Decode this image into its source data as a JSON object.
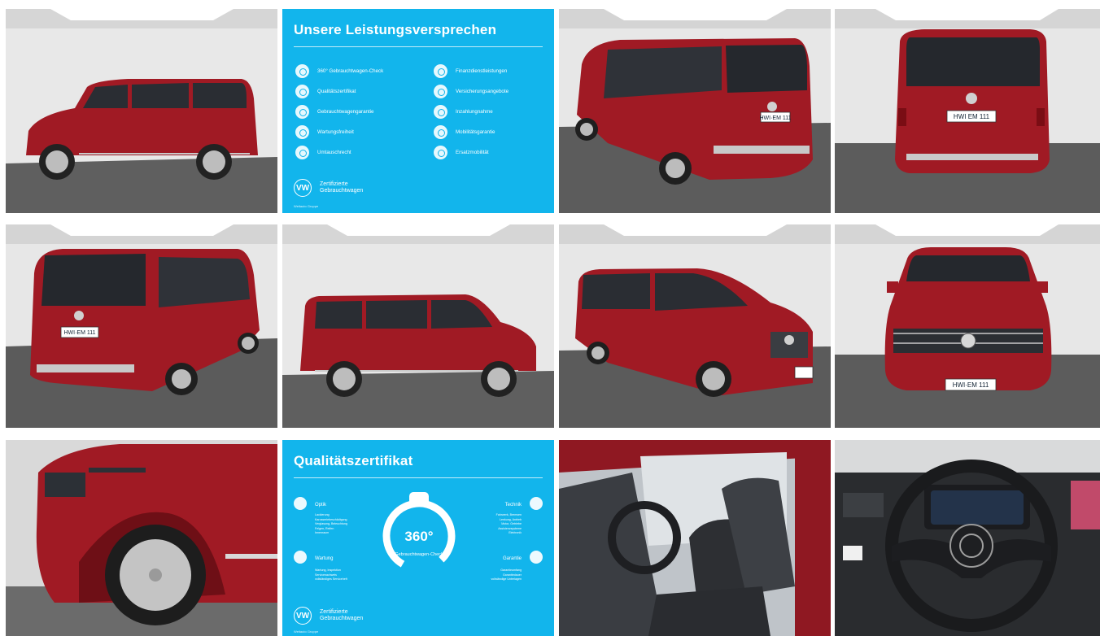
{
  "gallery": {
    "images": [
      {
        "view": "side-left-exterior"
      },
      {
        "view": "promo-services"
      },
      {
        "view": "rear-left-three-quarter"
      },
      {
        "view": "rear"
      },
      {
        "view": "rear-right-three-quarter"
      },
      {
        "view": "side-right-exterior"
      },
      {
        "view": "front-right-three-quarter"
      },
      {
        "view": "front"
      },
      {
        "view": "front-wheel-detail"
      },
      {
        "view": "promo-quality-certificate"
      },
      {
        "view": "interior-front-seats"
      },
      {
        "view": "steering-wheel-cockpit"
      }
    ]
  },
  "vehicle": {
    "plate": "HWI·EM 111",
    "plate_rear_short": "HWI EM 111",
    "plate_small": "HWI·EM 111"
  },
  "promo_services": {
    "title": "Unsere Leistungsversprechen",
    "left_items": [
      "360° Gebrauchtwagen-Check",
      "Qualitätszertifikat",
      "Gebrauchtwagengarantie",
      "Wartungsfreiheit",
      "Umtauschrecht"
    ],
    "right_items": [
      "Finanzdienstleistungen",
      "Versicherungsangebote",
      "Inzahlungnahme",
      "Mobilitätsgarantie",
      "Ersatzmobilität"
    ],
    "certified_label_line1": "Zertifizierte",
    "certified_label_line2": "Gebrauchtwagen",
    "brand_small": "Weltauto Gruppe"
  },
  "promo_quality": {
    "title": "Qualitätszertifikat",
    "section_optik": "Optik",
    "section_technik": "Technik",
    "section_wartung": "Wartung",
    "section_garantie": "Garantie",
    "badge_number": "360°",
    "badge_text": "Gebrauchtwagen-Check",
    "optik_items": [
      "Lackierung",
      "Karosseriebeschädigung",
      "Verglasung, Beleuchtung",
      "Felgen, Reifen",
      "Innenraum"
    ],
    "technik_items": [
      "Fahrwerk, Bremsen",
      "Lenkung, Antrieb",
      "Motor, Getriebe",
      "Assistenzsysteme",
      "Elektronik"
    ],
    "wartung_items": [
      "Wartung, Inspektion",
      "Servicenachweis",
      "vollständiges Serviceheft"
    ],
    "garantie_items": [
      "Garantieumfang",
      "Garantiedauer",
      "vollständige Unterlagen"
    ],
    "certified_label_line1": "Zertifizierte",
    "certified_label_line2": "Gebrauchtwagen",
    "brand_small": "Weltauto Gruppe"
  },
  "colors": {
    "car_red": "#a01a24",
    "car_red_dark": "#6e0f16",
    "studio_wall": "#e9e9e9",
    "studio_floor": "#5e5e5e",
    "promo_blue": "#12b5ec",
    "logo_text": "VW"
  }
}
